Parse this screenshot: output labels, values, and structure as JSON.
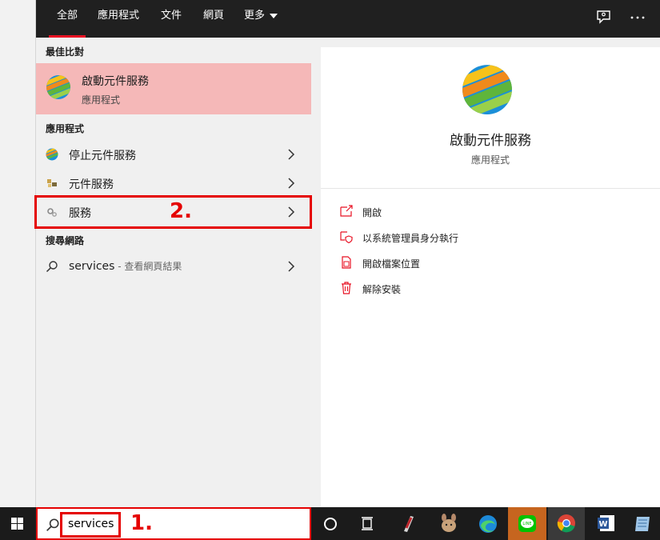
{
  "tabs": [
    {
      "label": "全部",
      "active": true
    },
    {
      "label": "應用程式"
    },
    {
      "label": "文件"
    },
    {
      "label": "網頁"
    },
    {
      "label": "更多"
    }
  ],
  "best_match": {
    "heading": "最佳比對",
    "title": "啟動元件服務",
    "subtitle": "應用程式"
  },
  "apps": {
    "heading": "應用程式",
    "items": [
      {
        "label": "停止元件服務"
      },
      {
        "label": "元件服務"
      },
      {
        "label": "服務"
      }
    ]
  },
  "web": {
    "heading": "搜尋網路",
    "query": "services",
    "suffix": " - 查看網頁結果"
  },
  "detail": {
    "name": "啟動元件服務",
    "type": "應用程式",
    "actions": [
      {
        "label": "開啟",
        "icon": "open-icon"
      },
      {
        "label": "以系統管理員身分執行",
        "icon": "shield-icon"
      },
      {
        "label": "開啟檔案位置",
        "icon": "file-location-icon"
      },
      {
        "label": "解除安裝",
        "icon": "trash-icon"
      }
    ]
  },
  "search": {
    "value": "services"
  },
  "annotations": {
    "one": "1.",
    "two": "2."
  },
  "colors": {
    "accent": "#e81123",
    "highlight": "#f5b8b8",
    "annotation": "#e50000"
  }
}
